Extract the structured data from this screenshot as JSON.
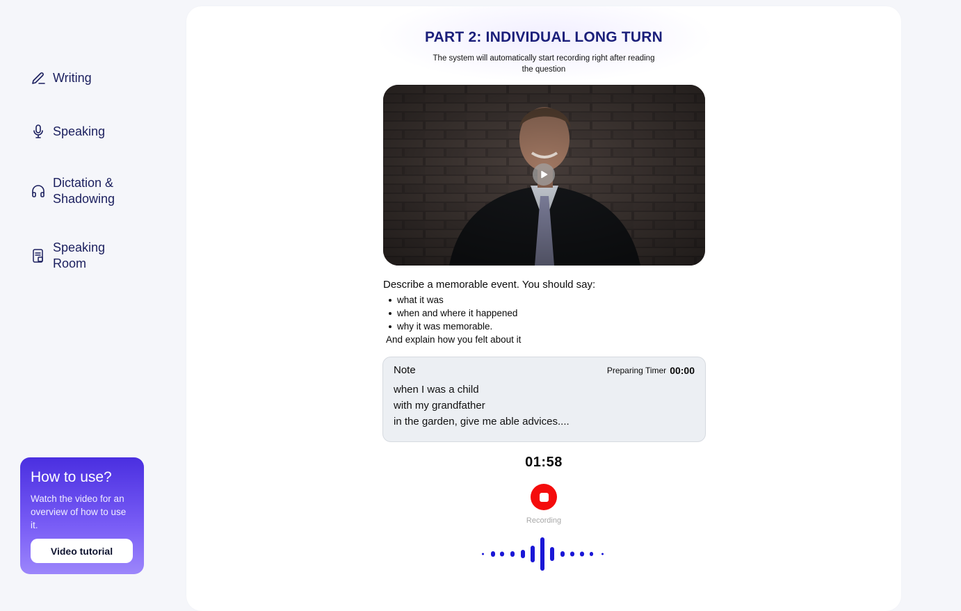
{
  "sidebar": {
    "items": [
      {
        "label": "Writing",
        "icon": "pencil-icon"
      },
      {
        "label": "Speaking",
        "icon": "microphone-icon"
      },
      {
        "label": "Dictation & Shadowing",
        "icon": "headphones-icon"
      },
      {
        "label": "Speaking Room",
        "icon": "document-room-icon"
      }
    ]
  },
  "howto": {
    "title": "How to use?",
    "description": "Watch the video for an overview of how to use it.",
    "button_label": "Video tutorial"
  },
  "main": {
    "title": "PART 2: INDIVIDUAL LONG TURN",
    "subtitle": "The system will automatically start recording right after reading the question",
    "question": {
      "lead": "Describe a memorable event.  You should say:",
      "bullets": [
        "what it was",
        "when and where it happened",
        "why it was memorable."
      ],
      "closing": "And explain how you felt about it"
    },
    "note": {
      "label": "Note",
      "timer_label": "Preparing Timer",
      "timer_value": "00:00",
      "text": "when I was a child\nwith my grandfather\nin the garden, give me able advices...."
    },
    "countdown": "01:58",
    "recording_label": "Recording"
  },
  "colors": {
    "accent": "#1b1f7a",
    "record": "#f40c0c",
    "wave": "#1a17d6",
    "howto_gradient_start": "#4a2fe0",
    "howto_gradient_end": "#9c86fb"
  }
}
